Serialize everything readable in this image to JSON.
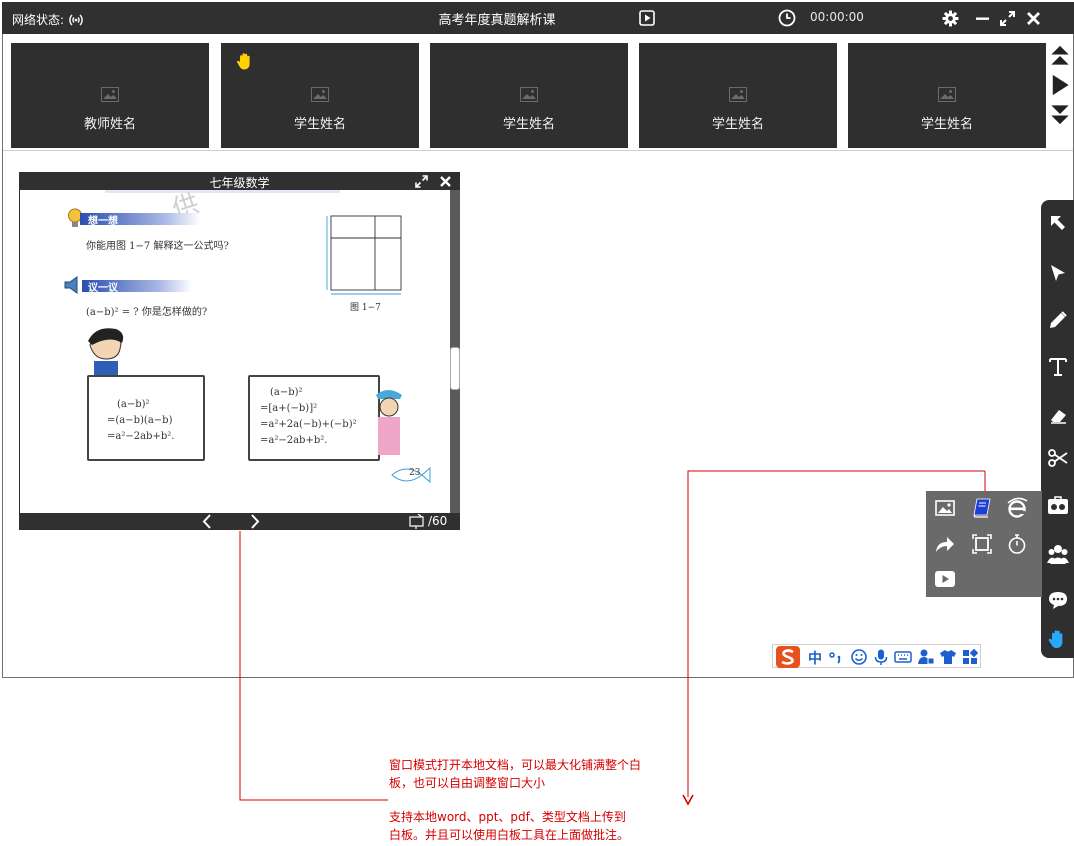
{
  "titlebar": {
    "network_label": "网络状态:",
    "title": "高考年度真题解析课",
    "timer": "00:00:00"
  },
  "videos": [
    {
      "name": "教师姓名",
      "hand_raised": false
    },
    {
      "name": "学生姓名",
      "hand_raised": true
    },
    {
      "name": "学生姓名",
      "hand_raised": false
    },
    {
      "name": "学生姓名",
      "hand_raised": false
    },
    {
      "name": "学生姓名",
      "hand_raised": false
    }
  ],
  "document": {
    "title": "七年级数学",
    "page_total": "/60",
    "content": {
      "watermark": "供",
      "think_heading": "想一想",
      "think_text": "你能用图 1−7 解释这一公式吗?",
      "discuss_heading": "议一议",
      "discuss_text": "(a−b)² = ? 你是怎样做的?",
      "figure_caption": "图 1−7",
      "left_board": [
        "(a−b)²",
        "=(a−b)(a−b)",
        "=a²−2ab+b²."
      ],
      "right_board": [
        "(a−b)²",
        "=[a+(−b)]²",
        "=a²+2a(−b)+(−b)²",
        "=a²−2ab+b²."
      ],
      "page_number": "23"
    }
  },
  "ime": {
    "mode": "中"
  },
  "annotations": {
    "note1_line1": "窗口模式打开本地文档，可以最大化铺满整个白",
    "note1_line2": "板，也可以自由调整窗口大小",
    "note2_line1": "支持本地word、ppt、pdf、类型文档上传到",
    "note2_line2": "白板。并且可以使用白板工具在上面做批注。"
  },
  "colors": {
    "chrome": "#303030",
    "annotation": "#d40000",
    "hand_active": "#2aa8ff",
    "hand_raise": "#ffd200"
  }
}
